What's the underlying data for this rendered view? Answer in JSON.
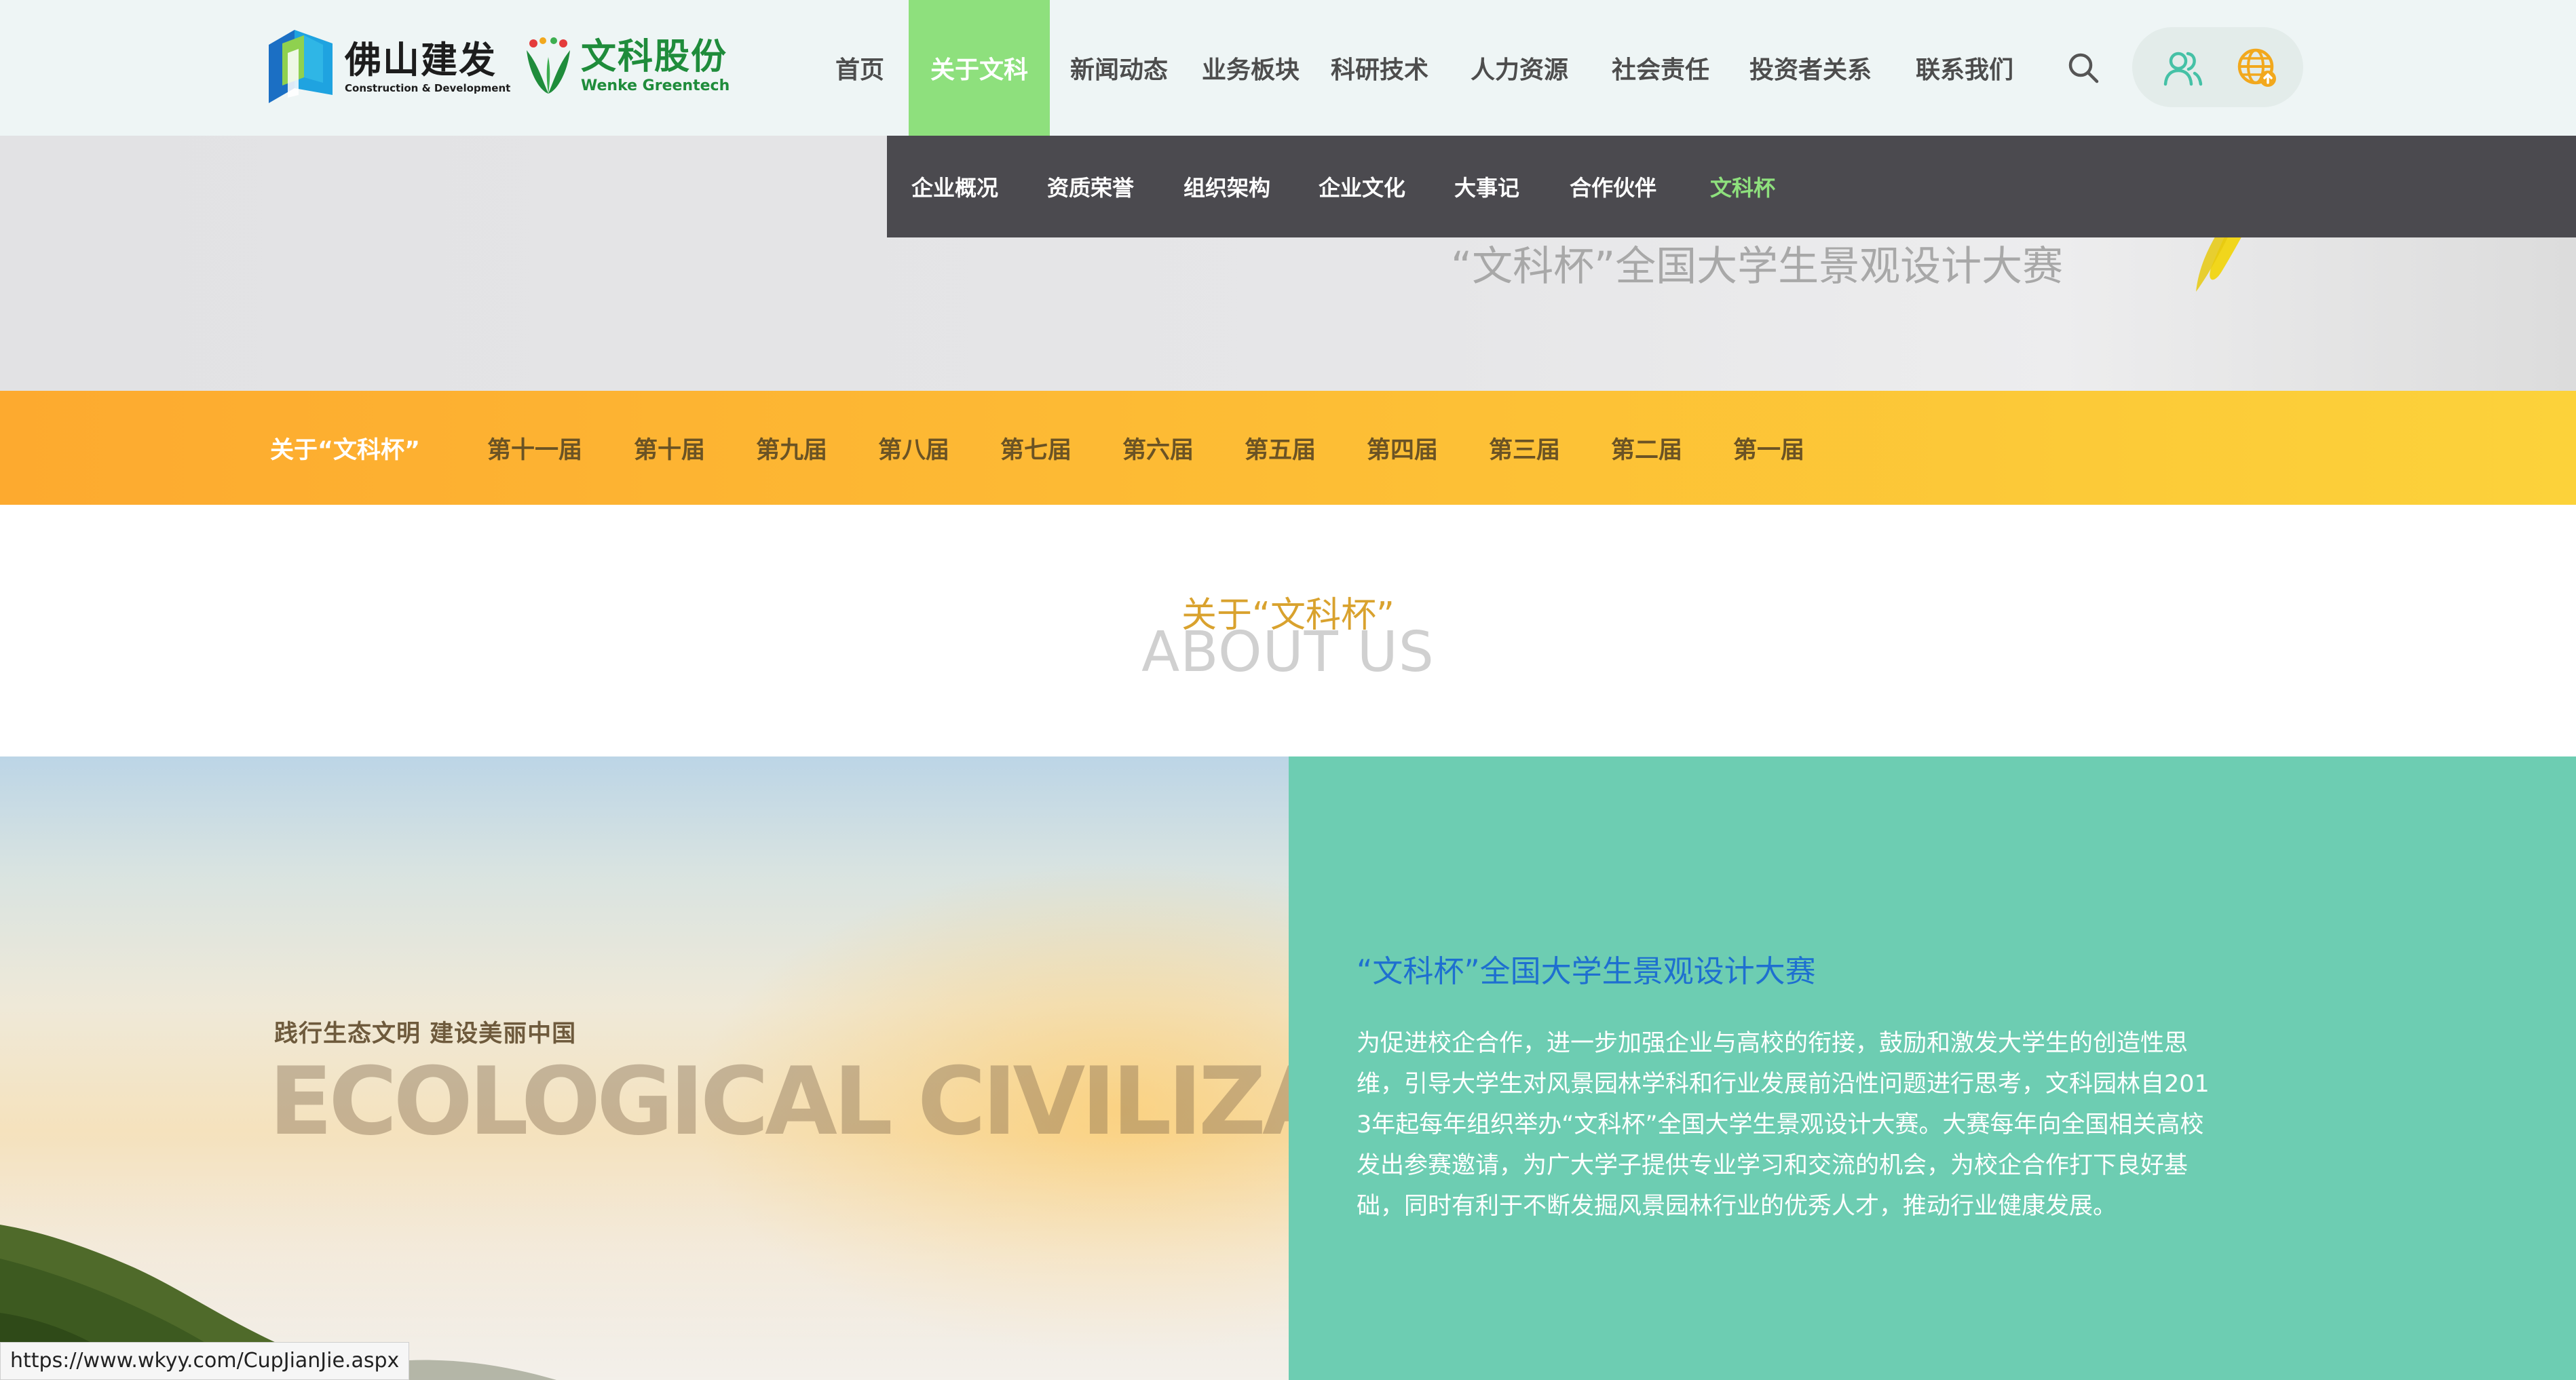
{
  "header": {
    "logo_jf_cn": "佛山建发",
    "logo_jf_en": "Construction & Development",
    "logo_wk_cn": "文科股份",
    "logo_wk_en": "Wenke Greentech"
  },
  "nav": {
    "items": [
      {
        "label": "首页"
      },
      {
        "label": "关于文科"
      },
      {
        "label": "新闻动态"
      },
      {
        "label": "业务板块"
      },
      {
        "label": "科研技术"
      },
      {
        "label": "人力资源"
      },
      {
        "label": "社会责任"
      },
      {
        "label": "投资者关系"
      },
      {
        "label": "联系我们"
      }
    ],
    "active": "关于文科"
  },
  "submenu": {
    "items": [
      {
        "label": "企业概况"
      },
      {
        "label": "资质荣誉"
      },
      {
        "label": "组织架构"
      },
      {
        "label": "企业文化"
      },
      {
        "label": "大事记"
      },
      {
        "label": "合作伙伴"
      },
      {
        "label": "文科杯"
      }
    ],
    "active": "文科杯"
  },
  "banner": {
    "title": "“文科杯”全国大学生景观设计大赛"
  },
  "sessions": {
    "items": [
      {
        "label": "关于“文科杯”"
      },
      {
        "label": "第十一届"
      },
      {
        "label": "第十届"
      },
      {
        "label": "第九届"
      },
      {
        "label": "第八届"
      },
      {
        "label": "第七届"
      },
      {
        "label": "第六届"
      },
      {
        "label": "第五届"
      },
      {
        "label": "第四届"
      },
      {
        "label": "第三届"
      },
      {
        "label": "第二届"
      },
      {
        "label": "第一届"
      }
    ],
    "active": "关于“文科杯”"
  },
  "about": {
    "title_cn": "关于“文科杯”",
    "title_en": "ABOUT US"
  },
  "photo": {
    "slogan": "践行生态文明   建设美丽中国",
    "big_text": "ECOLOGICAL CIVILIZATION"
  },
  "panel": {
    "title": "“文科杯”全国大学生景观设计大赛",
    "body": "为促进校企合作，进一步加强企业与高校的衔接，鼓励和激发大学生的创造性思维，引导大学生对风景园林学科和行业发展前沿性问题进行思考，文科园林自2013年起每年组织举办“文科杯”全国大学生景观设计大赛。大赛每年向全国相关高校发出参赛邀请，为广大学子提供专业学习和交流的机会，为校企合作打下良好基础，同时有利于不断发掘风景园林行业的优秀人才，推动行业健康发展。"
  },
  "status": {
    "url": "https://www.wkyy.com/CupJianJie.aspx"
  },
  "colors": {
    "nav_active_bg": "#8ee07d",
    "submenu_bg": "#4b4a4f",
    "submenu_active": "#8ee07d",
    "session_bar_start": "#fdaa2f",
    "session_bar_end": "#fcd23a",
    "about_title": "#d9a22e",
    "panel_bg": "#6dcdb2",
    "panel_title": "#1e6fd0"
  },
  "icons": {
    "search": "search-icon",
    "user": "user-icon",
    "globe": "globe-icon"
  }
}
